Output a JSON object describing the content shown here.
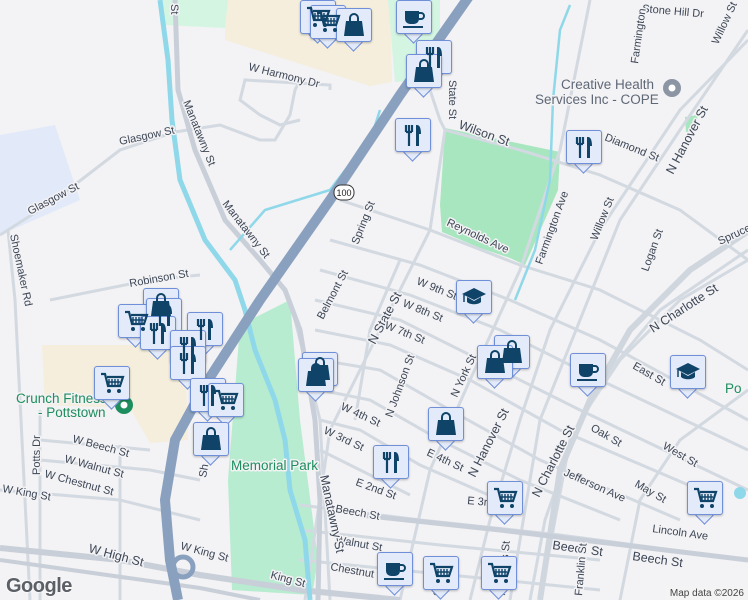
{
  "map": {
    "streets": {
      "manatawny_top": "St",
      "manatawny_1": "Manatawny St",
      "manatawny_2": "Manatawny St",
      "manatawny_3": "Manatawny St",
      "glasgow_1": "Glasgow St",
      "glasgow_2": "Glasgow St",
      "harmony": "W Harmony Dr",
      "shoemaker": "Shoemaker Rd",
      "robinson": "Robinson St",
      "spring": "Spring St",
      "route": "100",
      "state_top": "State St",
      "wilson": "Wilson St",
      "stone_hill": "Stone Hill Dr",
      "farmington_1": "Farmington",
      "farmington_2": "Farmington Ave",
      "diamond": "Diamond St",
      "hanover_1": "N Hanover St",
      "willow_1": "Willow St",
      "willow_2": "Willow St",
      "reynolds": "Reynolds Ave",
      "logan": "Logan St",
      "spruce": "Spruce",
      "w9th": "W 9th St",
      "belmont": "Belmont St",
      "n_state": "N State St",
      "w8th": "W 8th St",
      "w7th": "W 7th St",
      "johnson": "N Johnson St",
      "york": "N York St",
      "hanover_2": "N Hanover St",
      "charlotte_1": "N Charlotte St",
      "charlotte_2": "N Charlotte St",
      "east": "East St",
      "oak": "Oak St",
      "west": "West St",
      "jefferson": "Jefferson Ave",
      "may": "May St",
      "lincoln": "Lincoln Ave",
      "beech_1": "Beech St",
      "beech_2": "Beech St",
      "beech_3": "Beech St",
      "e4th": "E 4th St",
      "e3rd": "E 3r",
      "w4th": "W 4th St",
      "w3rd": "W 3rd St",
      "e2nd": "E 2nd St",
      "walnut": "Walnut St",
      "chestnut": "Chestnut",
      "w_beech": "W Beech St",
      "w_walnut": "W Walnut St",
      "w_chestnut": "W Chestnut St",
      "w_king": "W King St",
      "potts": "Potts Dr",
      "w_high": "W High St",
      "w_king_2": "W King St",
      "king": "King St",
      "evans": "N Evans St",
      "franklin": "Franklin St",
      "sh": "Sh",
      "er": "er St",
      "e2nd_short": "d St"
    },
    "places": {
      "creative_1": "Creative Health",
      "creative_2": "Services Inc - COPE",
      "crunch_1": "Crunch Fitness",
      "crunch_2": "- Pottstown",
      "memorial": "Memorial Park",
      "po": "Po"
    },
    "logo": "Google",
    "attribution": "Map data ©2026",
    "colors": {
      "marker_bg": "#e3ebfb",
      "marker_border": "#6f8fd8",
      "icon": "#0f4468",
      "park": "#a8e6c0",
      "highway": "#8aa0bf",
      "water": "#8fd8ea"
    }
  }
}
